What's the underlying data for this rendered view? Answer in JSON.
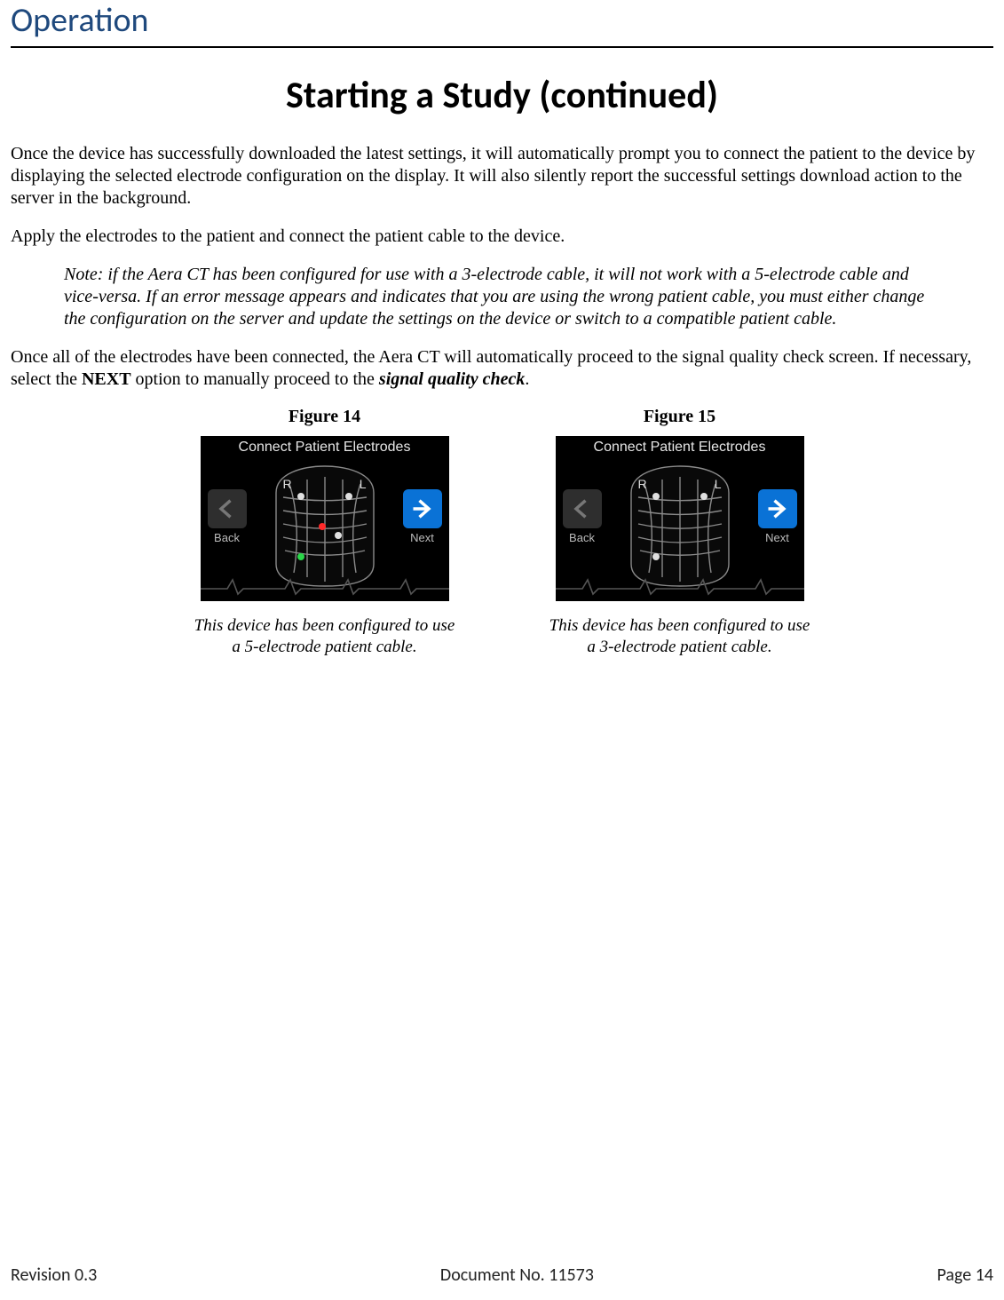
{
  "section": "Operation",
  "title": "Starting a Study (continued)",
  "p1": "Once the device has successfully downloaded the latest settings, it will automatically prompt you to connect the patient to the device by displaying the selected electrode configuration on the display. It will also silently report the successful settings download action to the server in the background.",
  "p2": "Apply the electrodes to the patient and connect the patient cable to the device.",
  "note": "Note: if the Aera CT has been configured for use with a 3-electrode cable, it will not work with a 5-electrode cable and vice-versa. If an error message appears and indicates that you are using the wrong patient cable, you must either change the configuration on the server and update the settings on the device or switch to a compatible patient cable.",
  "p3_a": "Once all of the electrodes have been connected, the Aera CT will automatically proceed to the signal quality check screen. If necessary, select the ",
  "p3_next": "NEXT",
  "p3_b": " option to manually proceed to the ",
  "p3_sqc": "signal quality check",
  "p3_c": ".",
  "figure14": {
    "label": "Figure 14",
    "screen_title": "Connect Patient Electrodes",
    "back": "Back",
    "next": "Next",
    "lead_r": "R",
    "lead_l": "L",
    "caption": "This device has been configured to use a 5-electrode patient cable."
  },
  "figure15": {
    "label": "Figure 15",
    "screen_title": "Connect Patient Electrodes",
    "back": "Back",
    "next": "Next",
    "lead_r": "R",
    "lead_l": "L",
    "caption": "This device has been configured to use a 3-electrode patient cable."
  },
  "footer": {
    "revision": "Revision 0.3",
    "docno": "Document No. 11573",
    "page": "Page 14"
  }
}
